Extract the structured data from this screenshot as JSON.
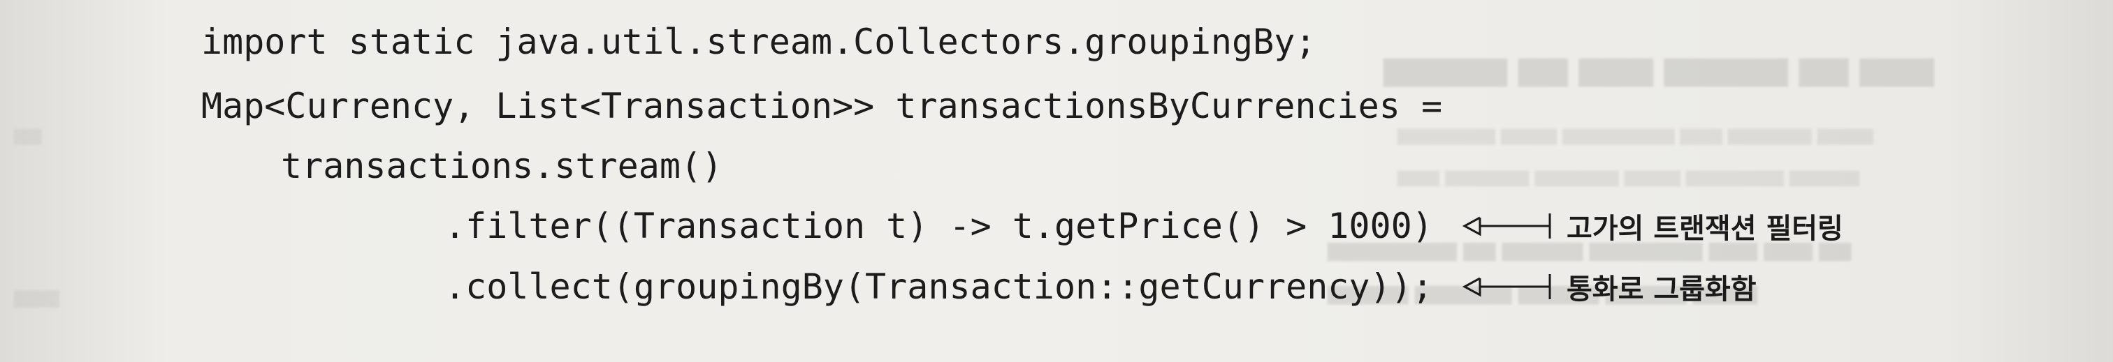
{
  "code_lines": [
    "import static java.util.stream.Collectors.groupingBy;",
    "Map<Currency, List<Transaction>> transactionsByCurrencies =",
    "transactions.stream()",
    ".filter((Transaction t) -> t.getPrice() > 1000)",
    ".collect(groupingBy(Transaction::getCurrency));"
  ],
  "annotations": [
    {
      "text": "고가의 트랜잭션 필터링",
      "icon": "left-arrow-icon"
    },
    {
      "text": "통화로 그룹화함",
      "icon": "left-arrow-icon"
    }
  ],
  "colors": {
    "text": "#1c1c1c",
    "background": "#f0efeb"
  }
}
